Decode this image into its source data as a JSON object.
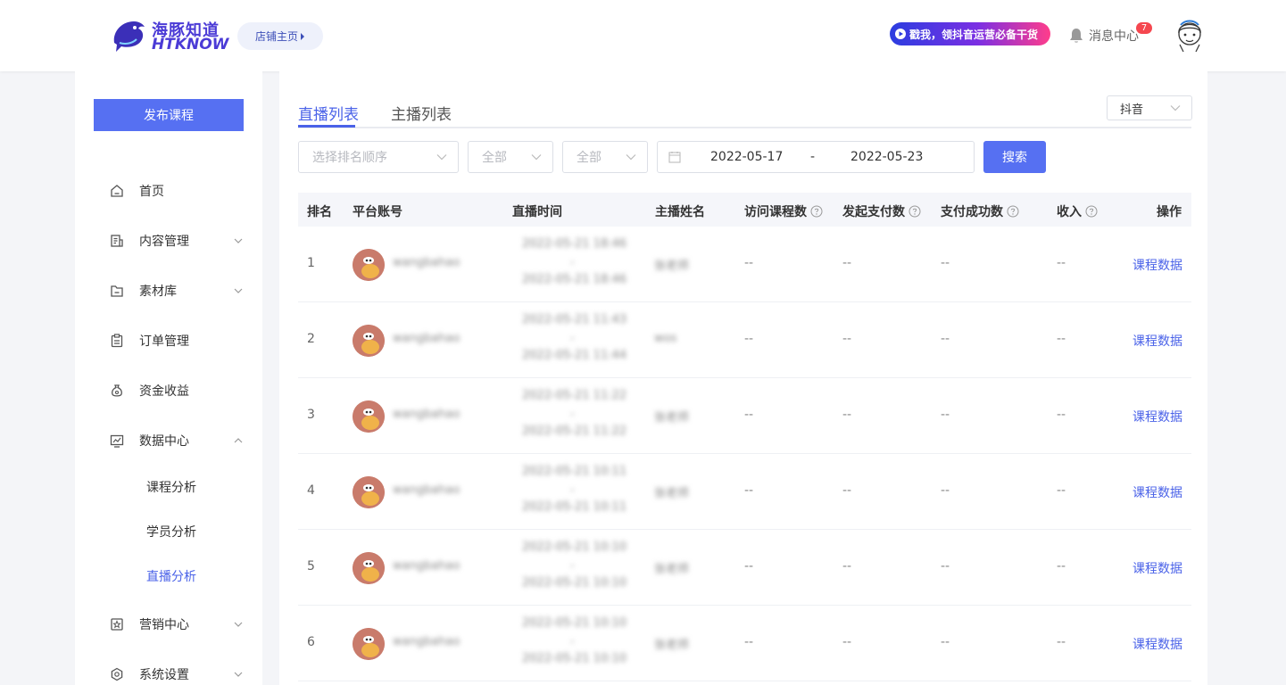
{
  "header": {
    "logo_cn": "海豚知道",
    "logo_en": "HTKNOW",
    "shop_button": "店铺主页",
    "promo_text": "戳我，领抖音运营必备干货",
    "message_center": "消息中心",
    "message_badge": "7"
  },
  "sidebar": {
    "publish_button": "发布课程",
    "items": [
      {
        "label": "首页",
        "icon": "home-icon"
      },
      {
        "label": "内容管理",
        "icon": "content-icon"
      },
      {
        "label": "素材库",
        "icon": "folder-icon"
      },
      {
        "label": "订单管理",
        "icon": "clipboard-icon"
      },
      {
        "label": "资金收益",
        "icon": "money-bag-icon"
      },
      {
        "label": "数据中心",
        "icon": "chart-icon"
      },
      {
        "label": "营销中心",
        "icon": "star-icon"
      },
      {
        "label": "系统设置",
        "icon": "settings-icon"
      }
    ],
    "data_center_sub": [
      "课程分析",
      "学员分析",
      "直播分析"
    ]
  },
  "tabs": [
    "直播列表",
    "主播列表"
  ],
  "platform_select": "抖音",
  "filters": {
    "rank_order_placeholder": "选择排名顺序",
    "filter2": "全部",
    "filter3": "全部",
    "date_start": "2022-05-17",
    "date_sep": "-",
    "date_end": "2022-05-23",
    "search_button": "搜索"
  },
  "table": {
    "columns": [
      "排名",
      "平台账号",
      "直播时间",
      "主播姓名",
      "访问课程数",
      "发起支付数",
      "支付成功数",
      "收入",
      "操作"
    ],
    "rows": [
      {
        "rank": "1",
        "account": "wangbahao",
        "start": "2022-05-21 18:46",
        "dash": "-",
        "end": "2022-05-21 18:46",
        "host": "张老师",
        "v1": "--",
        "v2": "--",
        "v3": "--",
        "v4": "--",
        "action": "课程数据"
      },
      {
        "rank": "2",
        "account": "wangbahao",
        "start": "2022-05-21 11:43",
        "dash": "-",
        "end": "2022-05-21 11:44",
        "host": "wos",
        "v1": "--",
        "v2": "--",
        "v3": "--",
        "v4": "--",
        "action": "课程数据"
      },
      {
        "rank": "3",
        "account": "wangbahao",
        "start": "2022-05-21 11:22",
        "dash": "-",
        "end": "2022-05-21 11:22",
        "host": "张老师",
        "v1": "--",
        "v2": "--",
        "v3": "--",
        "v4": "--",
        "action": "课程数据"
      },
      {
        "rank": "4",
        "account": "wangbahao",
        "start": "2022-05-21 10:11",
        "dash": "-",
        "end": "2022-05-21 10:11",
        "host": "张老师",
        "v1": "--",
        "v2": "--",
        "v3": "--",
        "v4": "--",
        "action": "课程数据"
      },
      {
        "rank": "5",
        "account": "wangbahao",
        "start": "2022-05-21 10:10",
        "dash": "-",
        "end": "2022-05-21 10:10",
        "host": "张老师",
        "v1": "--",
        "v2": "--",
        "v3": "--",
        "v4": "--",
        "action": "课程数据"
      },
      {
        "rank": "6",
        "account": "wangbahao",
        "start": "2022-05-21 10:10",
        "dash": "-",
        "end": "2022-05-21 10:10",
        "host": "张老师",
        "v1": "--",
        "v2": "--",
        "v3": "--",
        "v4": "--",
        "action": "课程数据"
      }
    ]
  },
  "colors": {
    "accent": "#4a62e8",
    "button": "#5670f2",
    "badge": "#f5474f"
  }
}
